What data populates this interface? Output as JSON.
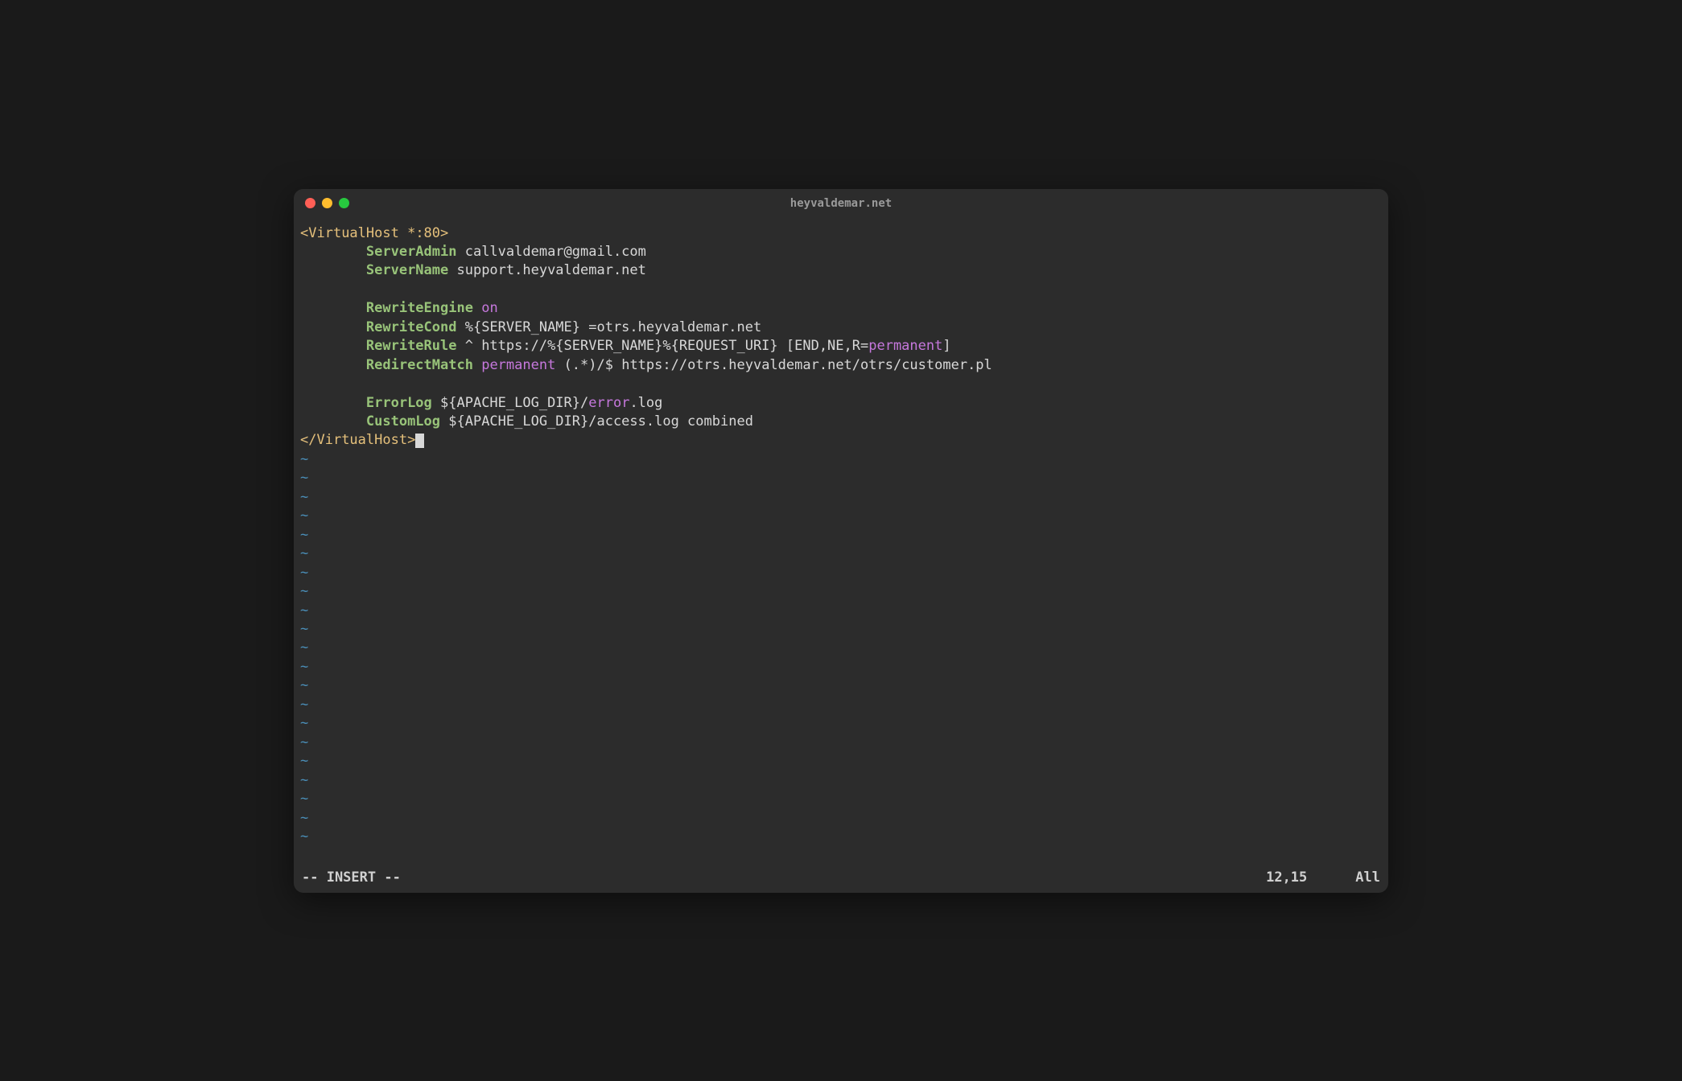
{
  "window": {
    "title": "heyvaldemar.net"
  },
  "colors": {
    "tag_keyword": "#e5c07b",
    "directive": "#98c379",
    "value_pink": "#c678dd",
    "plain": "#d8d8d8",
    "tilde": "#4a8eb8"
  },
  "editor": {
    "lines": [
      {
        "segments": [
          {
            "text": "<",
            "class": "c-yellow"
          },
          {
            "text": "VirtualHost",
            "class": "c-yellow"
          },
          {
            "text": " *:80",
            "class": "c-yellow"
          },
          {
            "text": ">",
            "class": "c-yellow"
          }
        ]
      },
      {
        "segments": [
          {
            "text": "        ",
            "class": "c-white"
          },
          {
            "text": "ServerAdmin",
            "class": "c-green"
          },
          {
            "text": " callvaldemar@gmail.com",
            "class": "c-white"
          }
        ]
      },
      {
        "segments": [
          {
            "text": "        ",
            "class": "c-white"
          },
          {
            "text": "ServerName",
            "class": "c-green"
          },
          {
            "text": " support.heyvaldemar.net",
            "class": "c-white"
          }
        ]
      },
      {
        "segments": [
          {
            "text": " ",
            "class": "c-white"
          }
        ]
      },
      {
        "segments": [
          {
            "text": "        ",
            "class": "c-white"
          },
          {
            "text": "RewriteEngine",
            "class": "c-green"
          },
          {
            "text": " ",
            "class": "c-white"
          },
          {
            "text": "on",
            "class": "c-pink"
          }
        ]
      },
      {
        "segments": [
          {
            "text": "        ",
            "class": "c-white"
          },
          {
            "text": "RewriteCond",
            "class": "c-green"
          },
          {
            "text": " %{SERVER_NAME} =otrs.heyvaldemar.net",
            "class": "c-white"
          }
        ]
      },
      {
        "segments": [
          {
            "text": "        ",
            "class": "c-white"
          },
          {
            "text": "RewriteRule",
            "class": "c-green"
          },
          {
            "text": " ^ https://%{SERVER_NAME}%{REQUEST_URI} [END,NE,R=",
            "class": "c-white"
          },
          {
            "text": "permanent",
            "class": "c-pink"
          },
          {
            "text": "]",
            "class": "c-white"
          }
        ]
      },
      {
        "segments": [
          {
            "text": "        ",
            "class": "c-white"
          },
          {
            "text": "RedirectMatch",
            "class": "c-green"
          },
          {
            "text": " ",
            "class": "c-white"
          },
          {
            "text": "permanent",
            "class": "c-pink"
          },
          {
            "text": " (.*)/$ https://otrs.heyvaldemar.net/otrs/customer.pl",
            "class": "c-white"
          }
        ]
      },
      {
        "segments": [
          {
            "text": " ",
            "class": "c-white"
          }
        ]
      },
      {
        "segments": [
          {
            "text": "        ",
            "class": "c-white"
          },
          {
            "text": "ErrorLog",
            "class": "c-green"
          },
          {
            "text": " ${APACHE_LOG_DIR}/",
            "class": "c-white"
          },
          {
            "text": "error",
            "class": "c-pink"
          },
          {
            "text": ".log",
            "class": "c-white"
          }
        ]
      },
      {
        "segments": [
          {
            "text": "        ",
            "class": "c-white"
          },
          {
            "text": "CustomLog",
            "class": "c-green"
          },
          {
            "text": " ${APACHE_LOG_DIR}/access.log combined",
            "class": "c-white"
          }
        ]
      },
      {
        "segments": [
          {
            "text": "</",
            "class": "c-yellow"
          },
          {
            "text": "VirtualHost",
            "class": "c-yellow"
          },
          {
            "text": ">",
            "class": "c-yellow"
          }
        ],
        "cursor_after": true
      }
    ],
    "tilde_char": "~",
    "tilde_count": 21
  },
  "status": {
    "mode": "-- INSERT --",
    "position": "12,15",
    "scroll": "All"
  }
}
